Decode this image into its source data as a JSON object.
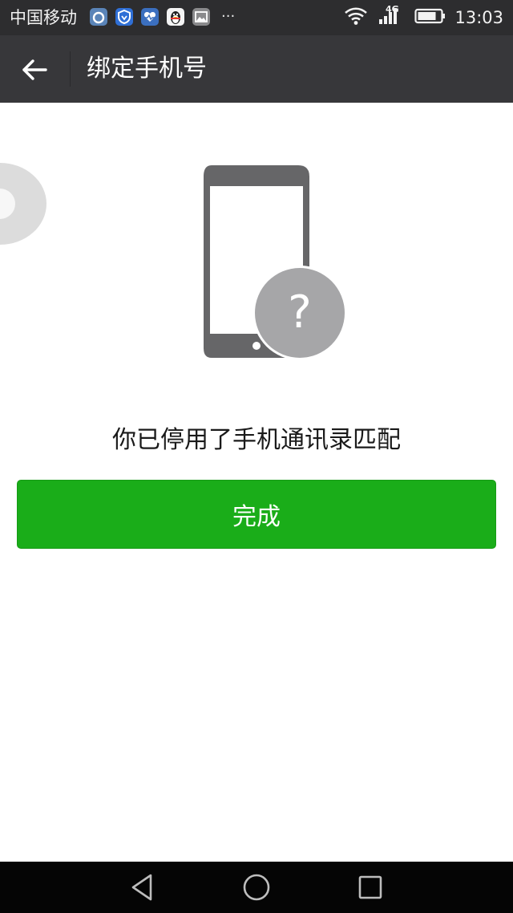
{
  "status_bar": {
    "carrier": "中国移动",
    "network": "4G",
    "time": "13:03",
    "more": "···",
    "notification_icons": [
      "browser-icon",
      "shield-icon",
      "health-icon",
      "qq-penguin-icon",
      "image-icon"
    ]
  },
  "toolbar": {
    "title": "绑定手机号"
  },
  "main": {
    "message": "你已停用了手机通讯录匹配",
    "help_symbol": "?",
    "done_label": "完成"
  },
  "colors": {
    "status_bar_bg": "#2d2d2f",
    "toolbar_bg": "#37373a",
    "primary_green": "#1aad19",
    "phone_gray": "#666668",
    "badge_gray": "#a6a6a8",
    "nav_bar_bg": "#050505"
  }
}
